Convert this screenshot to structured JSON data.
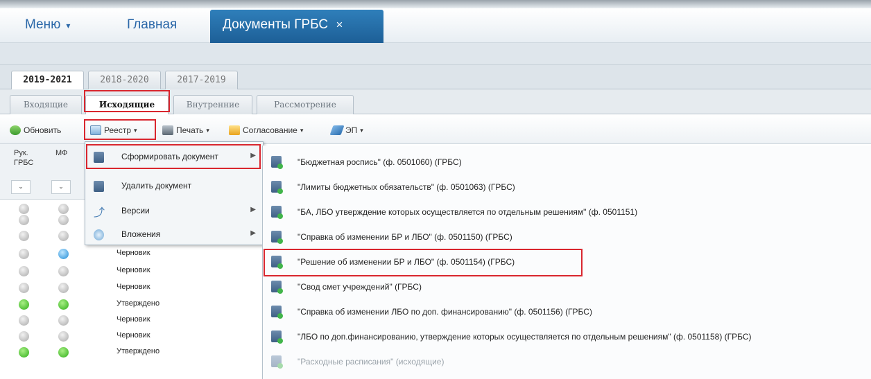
{
  "nav": {
    "menu_label": "Меню",
    "menu_caret": "▾",
    "main_label": "Главная",
    "active_tab_label": "Документы ГРБС",
    "close_glyph": "×"
  },
  "year_tabs": [
    "2019-2021",
    "2018-2020",
    "2017-2019"
  ],
  "sub_tabs": [
    "Входящие",
    "Исходящие",
    "Внутренние",
    "Рассмотрение"
  ],
  "toolbar": {
    "refresh": "Обновить",
    "registry": "Реестр",
    "print": "Печать",
    "approval": "Согласование",
    "ep": "ЭП",
    "dropdown_glyph": "▾"
  },
  "grid": {
    "col_head": "Рук.\nГРБС",
    "col_mf": "МФ",
    "filter_glyph": "⌄",
    "rows": [
      {
        "head": "grey",
        "mf": "grey",
        "status": ""
      },
      {
        "head": "grey",
        "mf": "grey",
        "status": ""
      },
      {
        "head": "grey",
        "mf": "grey",
        "status": ""
      },
      {
        "head": "grey",
        "mf": "blue",
        "status": "Черновик"
      },
      {
        "head": "grey",
        "mf": "grey",
        "status": "Черновик"
      },
      {
        "head": "grey",
        "mf": "grey",
        "status": "Черновик"
      },
      {
        "head": "green",
        "mf": "green",
        "status": "Утверждено"
      },
      {
        "head": "grey",
        "mf": "grey",
        "status": "Черновик"
      },
      {
        "head": "grey",
        "mf": "grey",
        "status": "Черновик"
      },
      {
        "head": "green",
        "mf": "green",
        "status": "Утверждено"
      }
    ]
  },
  "registry_menu": [
    {
      "label": "Сформировать документ",
      "has_submenu": true
    },
    {
      "label": "Удалить документ",
      "has_submenu": false
    },
    {
      "label": "Версии",
      "has_submenu": true
    },
    {
      "label": "Вложения",
      "has_submenu": true
    }
  ],
  "submenu_arrow": "▶",
  "create_document_menu": [
    {
      "label": "\"Бюджетная роспись\" (ф. 0501060) (ГРБС)",
      "enabled": true
    },
    {
      "label": "\"Лимиты бюджетных обязательств\" (ф. 0501063) (ГРБС)",
      "enabled": true
    },
    {
      "label": "\"БА, ЛБО утверждение которых осуществляется по отдельным решениям\" (ф. 0501151)",
      "enabled": true
    },
    {
      "label": "\"Справка об изменении БР и ЛБО\" (ф. 0501150) (ГРБС)",
      "enabled": true
    },
    {
      "label": "\"Решение об изменении БР и ЛБО\" (ф. 0501154) (ГРБС)",
      "enabled": true
    },
    {
      "label": "\"Свод смет учреждений\" (ГРБС)",
      "enabled": true
    },
    {
      "label": "\"Справка об изменении ЛБО по доп. финансированию\" (ф. 0501156) (ГРБС)",
      "enabled": true
    },
    {
      "label": "\"ЛБО по доп.финансированию, утверждение которых осуществляется по отдельным решениям\" (ф. 0501158) (ГРБС)",
      "enabled": true
    },
    {
      "label": "\"Расходные расписания\" (исходящие)",
      "enabled": false
    }
  ],
  "colors": {
    "nav_tab_bg": "#1d5f97",
    "link": "#2a67a8",
    "highlight": "#d9262e",
    "status_green": "#2fae18",
    "status_blue": "#1e8bd6",
    "status_grey": "#a9a9a9"
  }
}
